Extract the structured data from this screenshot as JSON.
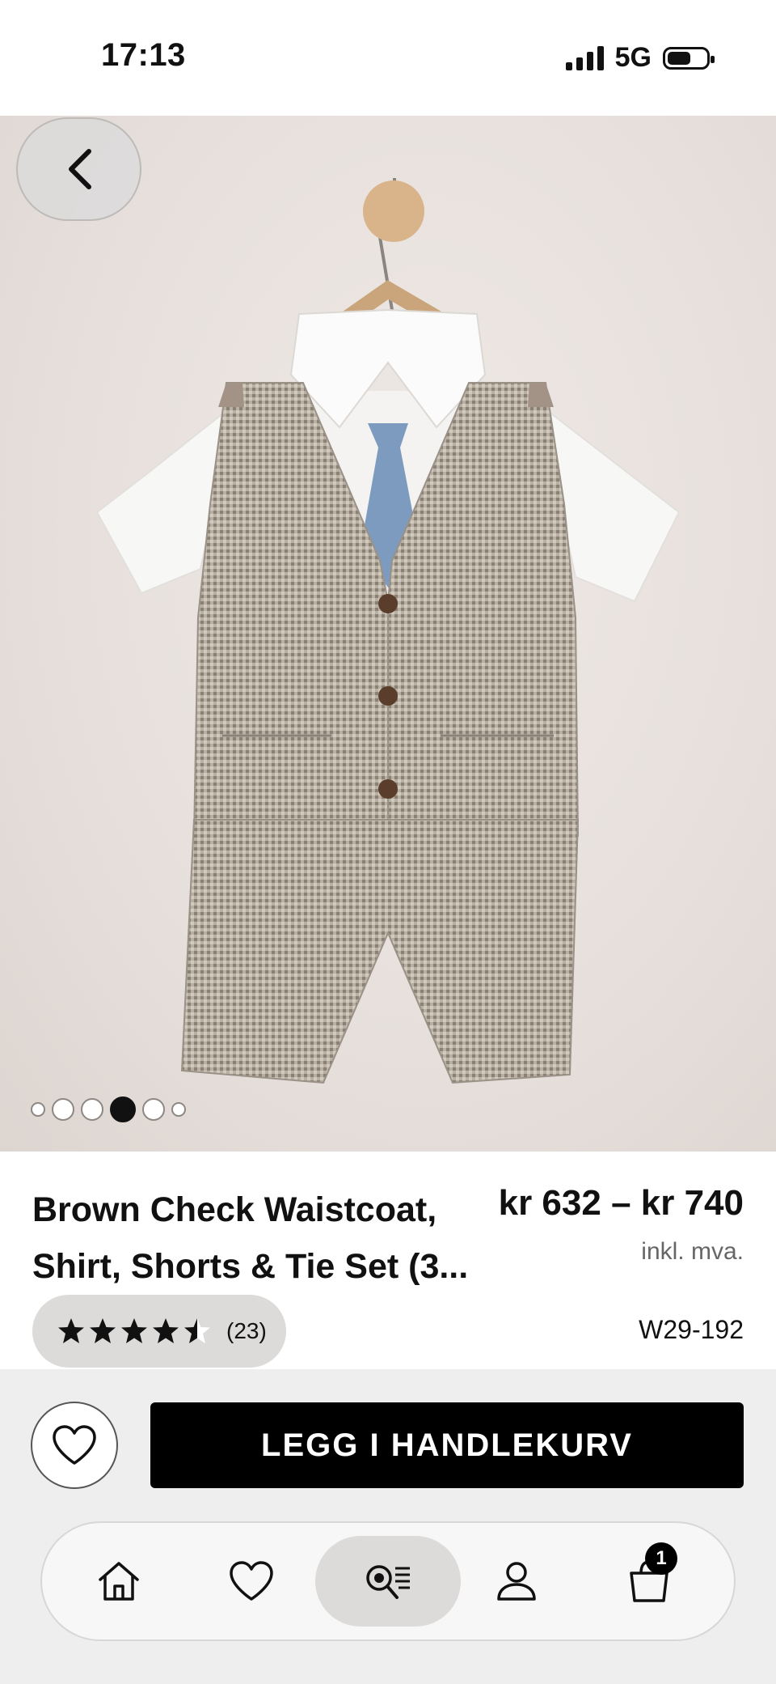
{
  "status_bar": {
    "time": "17:13",
    "network": "5G",
    "battery_level": 0.6
  },
  "product": {
    "title_line1": "Brown Check Waistcoat,",
    "title_line2": "Shirt, Shorts & Tie Set (3...",
    "price": "kr 632 – kr 740",
    "vat_note": "inkl. mva.",
    "rating": 4.5,
    "rating_count": "(23)",
    "size_code": "W29-192"
  },
  "gallery": {
    "image_count": 6,
    "active_index": 3
  },
  "actions": {
    "add_to_cart_label": "LEGG I HANDLEKURV"
  },
  "tabbar": {
    "items": [
      {
        "name": "home",
        "icon": "home-icon"
      },
      {
        "name": "favourites",
        "icon": "heart-icon"
      },
      {
        "name": "search",
        "icon": "search-list-icon",
        "active": true
      },
      {
        "name": "account",
        "icon": "user-icon"
      },
      {
        "name": "bag",
        "icon": "shopping-bag-icon"
      }
    ],
    "bag_count": "1"
  },
  "colors": {
    "accent": "#000000",
    "background_image": "#e8e2df",
    "rating_pill": "#dddbd9"
  }
}
